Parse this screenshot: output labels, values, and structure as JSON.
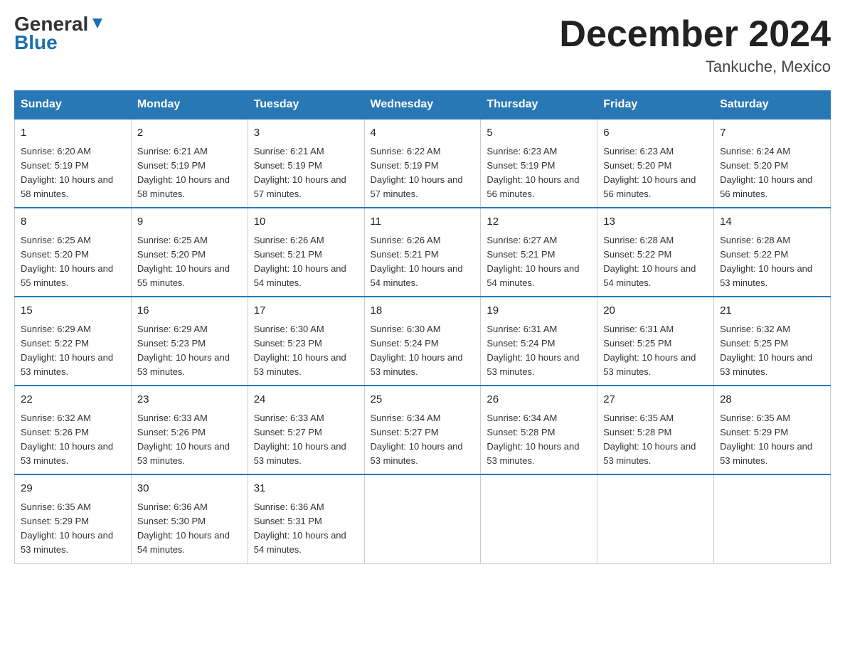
{
  "header": {
    "logo_general": "General",
    "logo_blue": "Blue",
    "month_title": "December 2024",
    "location": "Tankuche, Mexico"
  },
  "days_of_week": [
    "Sunday",
    "Monday",
    "Tuesday",
    "Wednesday",
    "Thursday",
    "Friday",
    "Saturday"
  ],
  "weeks": [
    [
      {
        "day": "1",
        "sunrise": "6:20 AM",
        "sunset": "5:19 PM",
        "daylight": "10 hours and 58 minutes."
      },
      {
        "day": "2",
        "sunrise": "6:21 AM",
        "sunset": "5:19 PM",
        "daylight": "10 hours and 58 minutes."
      },
      {
        "day": "3",
        "sunrise": "6:21 AM",
        "sunset": "5:19 PM",
        "daylight": "10 hours and 57 minutes."
      },
      {
        "day": "4",
        "sunrise": "6:22 AM",
        "sunset": "5:19 PM",
        "daylight": "10 hours and 57 minutes."
      },
      {
        "day": "5",
        "sunrise": "6:23 AM",
        "sunset": "5:19 PM",
        "daylight": "10 hours and 56 minutes."
      },
      {
        "day": "6",
        "sunrise": "6:23 AM",
        "sunset": "5:20 PM",
        "daylight": "10 hours and 56 minutes."
      },
      {
        "day": "7",
        "sunrise": "6:24 AM",
        "sunset": "5:20 PM",
        "daylight": "10 hours and 56 minutes."
      }
    ],
    [
      {
        "day": "8",
        "sunrise": "6:25 AM",
        "sunset": "5:20 PM",
        "daylight": "10 hours and 55 minutes."
      },
      {
        "day": "9",
        "sunrise": "6:25 AM",
        "sunset": "5:20 PM",
        "daylight": "10 hours and 55 minutes."
      },
      {
        "day": "10",
        "sunrise": "6:26 AM",
        "sunset": "5:21 PM",
        "daylight": "10 hours and 54 minutes."
      },
      {
        "day": "11",
        "sunrise": "6:26 AM",
        "sunset": "5:21 PM",
        "daylight": "10 hours and 54 minutes."
      },
      {
        "day": "12",
        "sunrise": "6:27 AM",
        "sunset": "5:21 PM",
        "daylight": "10 hours and 54 minutes."
      },
      {
        "day": "13",
        "sunrise": "6:28 AM",
        "sunset": "5:22 PM",
        "daylight": "10 hours and 54 minutes."
      },
      {
        "day": "14",
        "sunrise": "6:28 AM",
        "sunset": "5:22 PM",
        "daylight": "10 hours and 53 minutes."
      }
    ],
    [
      {
        "day": "15",
        "sunrise": "6:29 AM",
        "sunset": "5:22 PM",
        "daylight": "10 hours and 53 minutes."
      },
      {
        "day": "16",
        "sunrise": "6:29 AM",
        "sunset": "5:23 PM",
        "daylight": "10 hours and 53 minutes."
      },
      {
        "day": "17",
        "sunrise": "6:30 AM",
        "sunset": "5:23 PM",
        "daylight": "10 hours and 53 minutes."
      },
      {
        "day": "18",
        "sunrise": "6:30 AM",
        "sunset": "5:24 PM",
        "daylight": "10 hours and 53 minutes."
      },
      {
        "day": "19",
        "sunrise": "6:31 AM",
        "sunset": "5:24 PM",
        "daylight": "10 hours and 53 minutes."
      },
      {
        "day": "20",
        "sunrise": "6:31 AM",
        "sunset": "5:25 PM",
        "daylight": "10 hours and 53 minutes."
      },
      {
        "day": "21",
        "sunrise": "6:32 AM",
        "sunset": "5:25 PM",
        "daylight": "10 hours and 53 minutes."
      }
    ],
    [
      {
        "day": "22",
        "sunrise": "6:32 AM",
        "sunset": "5:26 PM",
        "daylight": "10 hours and 53 minutes."
      },
      {
        "day": "23",
        "sunrise": "6:33 AM",
        "sunset": "5:26 PM",
        "daylight": "10 hours and 53 minutes."
      },
      {
        "day": "24",
        "sunrise": "6:33 AM",
        "sunset": "5:27 PM",
        "daylight": "10 hours and 53 minutes."
      },
      {
        "day": "25",
        "sunrise": "6:34 AM",
        "sunset": "5:27 PM",
        "daylight": "10 hours and 53 minutes."
      },
      {
        "day": "26",
        "sunrise": "6:34 AM",
        "sunset": "5:28 PM",
        "daylight": "10 hours and 53 minutes."
      },
      {
        "day": "27",
        "sunrise": "6:35 AM",
        "sunset": "5:28 PM",
        "daylight": "10 hours and 53 minutes."
      },
      {
        "day": "28",
        "sunrise": "6:35 AM",
        "sunset": "5:29 PM",
        "daylight": "10 hours and 53 minutes."
      }
    ],
    [
      {
        "day": "29",
        "sunrise": "6:35 AM",
        "sunset": "5:29 PM",
        "daylight": "10 hours and 53 minutes."
      },
      {
        "day": "30",
        "sunrise": "6:36 AM",
        "sunset": "5:30 PM",
        "daylight": "10 hours and 54 minutes."
      },
      {
        "day": "31",
        "sunrise": "6:36 AM",
        "sunset": "5:31 PM",
        "daylight": "10 hours and 54 minutes."
      },
      null,
      null,
      null,
      null
    ]
  ],
  "labels": {
    "sunrise_prefix": "Sunrise: ",
    "sunset_prefix": "Sunset: ",
    "daylight_prefix": "Daylight: "
  }
}
